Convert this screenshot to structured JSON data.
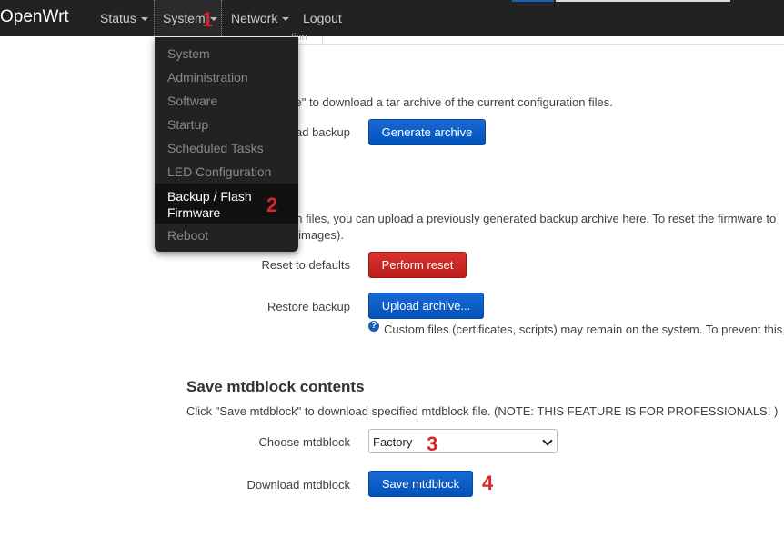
{
  "brand": "OpenWrt",
  "nav": {
    "status": "Status",
    "system": "System",
    "network": "Network",
    "logout": "Logout"
  },
  "tab_partial": "tion",
  "dropdown": {
    "items": [
      "System",
      "Administration",
      "Software",
      "Startup",
      "Scheduled Tasks",
      "LED Configuration"
    ],
    "active_line1": "Backup / Flash",
    "active_line2": "Firmware",
    "last": "Reboot"
  },
  "backup": {
    "intro": "ve\" to download a tar archive of the current configuration files.",
    "download_label": "ad backup",
    "generate_button": "Generate archive"
  },
  "restore": {
    "intro_line1": "on files, you can upload a previously generated backup archive here. To reset the firmware to",
    "intro_line2": "s images).",
    "reset_label": "Reset to defaults",
    "reset_button": "Perform reset",
    "restore_label": "Restore backup",
    "upload_button": "Upload archive...",
    "help_text": "Custom files (certificates, scripts) may remain on the system. To prevent this,"
  },
  "mtd": {
    "title": "Save mtdblock contents",
    "description": "Click \"Save mtdblock\" to download specified mtdblock file. (NOTE: THIS FEATURE IS FOR PROFESSIONALS! )",
    "choose_label": "Choose mtdblock",
    "selected": "Factory",
    "download_label": "Download mtdblock",
    "save_button": "Save mtdblock"
  },
  "annotations": [
    "1",
    "2",
    "3",
    "4"
  ],
  "colors": {
    "accent_red": "#d9262c",
    "button_blue": "#0053bb",
    "button_red": "#bb1e1a",
    "topbar": "#222222"
  }
}
